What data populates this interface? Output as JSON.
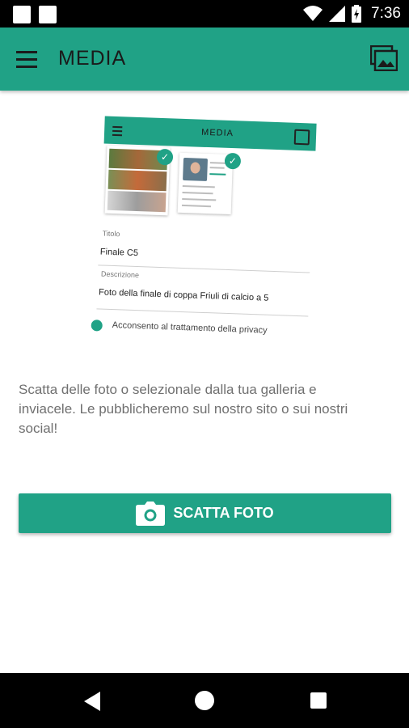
{
  "status_bar": {
    "time": "7:36",
    "icons": [
      "notification-square-icon",
      "notification-square-icon",
      "wifi-icon",
      "cellular-signal-icon",
      "battery-charging-icon"
    ]
  },
  "app_bar": {
    "title": "MEDIA",
    "left_icon": "menu-icon",
    "right_icon": "gallery-icon"
  },
  "illustration": {
    "title": "MEDIA",
    "field_title_label": "Titolo",
    "field_title_value": "Finale C5",
    "field_description_label": "Descrizione",
    "field_description_value": "Foto della finale di coppa Friuli di calcio a 5",
    "privacy_text": "Acconsento al trattamento della privacy"
  },
  "main": {
    "description": "Scatta delle foto o selezionale dalla tua galleria e inviacele. Le pubblicheremo sul nostro sito o sui nostri social!",
    "button_label": "SCATTA FOTO",
    "button_icon": "camera-icon"
  },
  "nav_bar": {
    "icons": [
      "back-icon",
      "home-icon",
      "recent-apps-icon"
    ]
  },
  "colors": {
    "primary": "#20a286",
    "status_bar": "#000000",
    "text_secondary": "#707070"
  }
}
